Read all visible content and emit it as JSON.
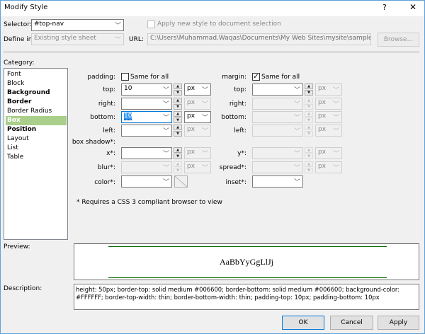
{
  "window": {
    "title": "Modify Style",
    "help": "?",
    "close": "✕"
  },
  "selector": {
    "label": "Selector:",
    "value": "#top-nav"
  },
  "apply_checkbox": {
    "label": "Apply new style to document selection",
    "checked": false
  },
  "define_in": {
    "label": "Define in:",
    "value": "Existing style sheet"
  },
  "url": {
    "label": "URL:",
    "value": "C:\\Users\\Muhammad.Waqas\\Documents\\My Web Sites\\mysite\\sample.css"
  },
  "browse_label": "Browse...",
  "category": {
    "label": "Category:",
    "items": [
      "Font",
      "Block",
      "Background",
      "Border",
      "Border Radius",
      "Box",
      "Position",
      "Layout",
      "List",
      "Table"
    ],
    "selected": "Box"
  },
  "padding": {
    "label": "padding:",
    "same_for_all": "Same for all",
    "same_checked": false,
    "top": {
      "label": "top:",
      "value": "10",
      "unit": "px"
    },
    "right": {
      "label": "right:",
      "value": "",
      "unit": "px"
    },
    "bottom": {
      "label": "bottom:",
      "value": "10",
      "unit": "px"
    },
    "left": {
      "label": "left:",
      "value": "",
      "unit": "px"
    }
  },
  "margin": {
    "label": "margin:",
    "same_for_all": "Same for all",
    "same_checked": true,
    "top": {
      "label": "top:",
      "value": "",
      "unit": "px"
    },
    "right": {
      "label": "right:",
      "unit": "px"
    },
    "bottom": {
      "label": "bottom:",
      "unit": "px"
    },
    "left": {
      "label": "left:",
      "unit": "px"
    }
  },
  "box_shadow": {
    "label": "box shadow*:",
    "x": {
      "label": "x*:",
      "unit": "px"
    },
    "y": {
      "label": "y*:",
      "unit": "px"
    },
    "blur": {
      "label": "blur*:",
      "unit": "px"
    },
    "spread": {
      "label": "spread*:",
      "unit": "px"
    },
    "color": {
      "label": "color*:"
    },
    "inset": {
      "label": "inset*:"
    }
  },
  "note": "* Requires a CSS 3 compliant browser to view",
  "preview": {
    "label": "Preview:",
    "sample": "AaBbYyGgLlJj",
    "border_color": "#006600"
  },
  "description": {
    "label": "Description:",
    "text": "height: 50px; border-top: solid medium #006600; border-bottom: solid medium #006600; background-color: #FFFFFF; border-top-width: thin; border-bottom-width: thin; padding-top: 10px; padding-bottom: 10px"
  },
  "buttons": {
    "ok": "OK",
    "cancel": "Cancel",
    "apply": "Apply"
  }
}
